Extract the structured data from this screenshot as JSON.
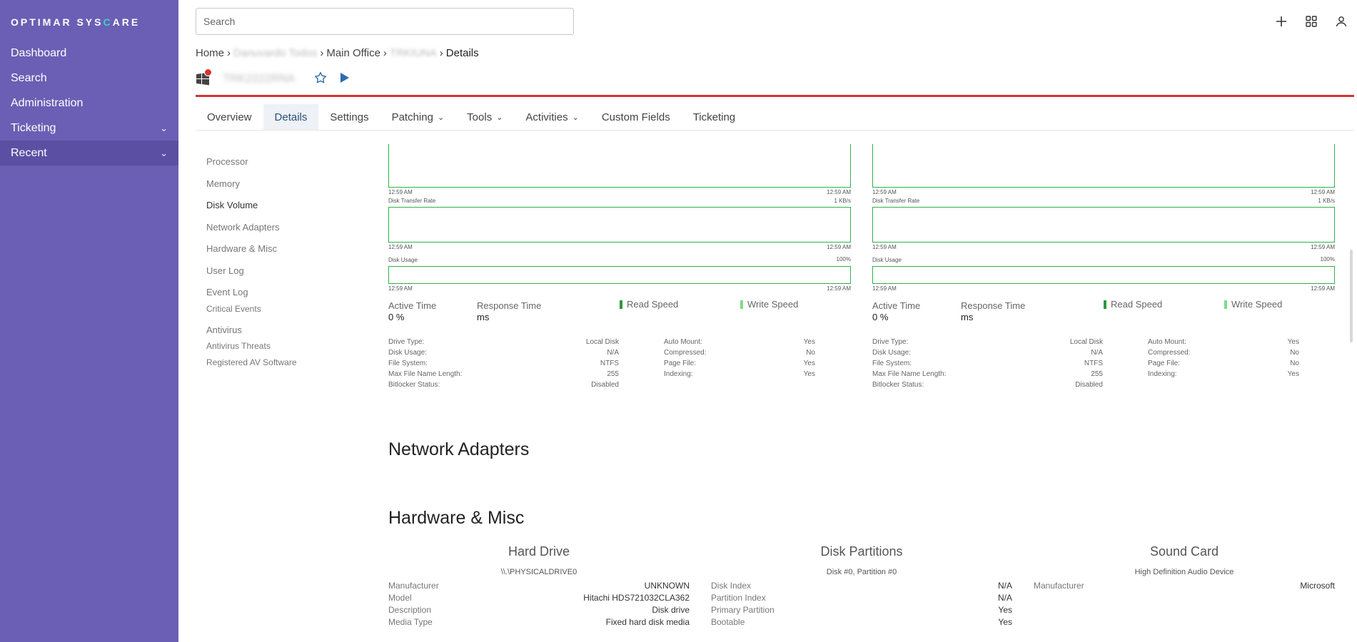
{
  "app": {
    "logo_a": "OPTIMAR SYS",
    "logo_c": "C",
    "logo_b": "ARE"
  },
  "sidebar": {
    "items": [
      {
        "label": "Dashboard",
        "chev": ""
      },
      {
        "label": "Search",
        "chev": ""
      },
      {
        "label": "Administration",
        "chev": ""
      },
      {
        "label": "Ticketing",
        "chev": "⌄"
      },
      {
        "label": "Recent",
        "chev": "⌄"
      }
    ]
  },
  "search": {
    "placeholder": "Search"
  },
  "breadcrumb": {
    "home": "Home",
    "site": "Danuvardo Todos",
    "office": "Main Office",
    "device": "TRKIUNA",
    "current": "Details",
    "sep": "›"
  },
  "device": {
    "name": "TRK2222RNA"
  },
  "tabs": [
    {
      "label": "Overview",
      "chev": ""
    },
    {
      "label": "Details",
      "chev": ""
    },
    {
      "label": "Settings",
      "chev": ""
    },
    {
      "label": "Patching",
      "chev": "⌄"
    },
    {
      "label": "Tools",
      "chev": "⌄"
    },
    {
      "label": "Activities",
      "chev": "⌄"
    },
    {
      "label": "Custom Fields",
      "chev": ""
    },
    {
      "label": "Ticketing",
      "chev": ""
    }
  ],
  "subnav": [
    "Processor",
    "Memory",
    "Disk Volume",
    "Network Adapters",
    "Hardware & Misc",
    "User Log",
    "Event Log",
    "Critical Events",
    "Antivirus",
    "Antivirus Threats",
    "Registered AV Software"
  ],
  "disk": {
    "time": "12:59 AM",
    "transfer_label": "Disk Transfer Rate",
    "transfer_max": "1 KB/s",
    "usage_label": "Disk Usage",
    "usage_max": "100%",
    "active_time_label": "Active Time",
    "active_time_val": "0 %",
    "response_time_label": "Response Time",
    "response_time_val": "ms",
    "read_speed": "Read Speed",
    "write_speed": "Write Speed",
    "read_color": "#2a9a3c",
    "write_color": "#7edb8a",
    "left_info": [
      {
        "k": "Drive Type:",
        "v": "Local Disk"
      },
      {
        "k": "Disk Usage:",
        "v": "N/A"
      },
      {
        "k": "File System:",
        "v": "NTFS"
      },
      {
        "k": "Max File Name Length:",
        "v": "255"
      },
      {
        "k": "Bitlocker Status:",
        "v": "Disabled"
      }
    ],
    "right_info": [
      {
        "k": "Auto Mount:",
        "v": "Yes"
      },
      {
        "k": "Compressed:",
        "v": "No"
      },
      {
        "k": "Page File:",
        "v": "Yes"
      },
      {
        "k": "Indexing:",
        "v": "Yes"
      }
    ],
    "right_info_2": [
      {
        "k": "Auto Mount:",
        "v": "Yes"
      },
      {
        "k": "Compressed:",
        "v": "No"
      },
      {
        "k": "Page File:",
        "v": "No"
      },
      {
        "k": "Indexing:",
        "v": "Yes"
      }
    ]
  },
  "sections": {
    "network": "Network Adapters",
    "hardware": "Hardware & Misc"
  },
  "hardware": {
    "hard_drive": {
      "title": "Hard Drive",
      "sub": "\\\\.\\PHYSICALDRIVE0",
      "rows": [
        {
          "k": "Manufacturer",
          "v": "UNKNOWN"
        },
        {
          "k": "Model",
          "v": "Hitachi HDS721032CLA362"
        },
        {
          "k": "Description",
          "v": "Disk drive"
        },
        {
          "k": "Media Type",
          "v": "Fixed hard disk media"
        }
      ]
    },
    "partitions": {
      "title": "Disk Partitions",
      "sub": "Disk #0, Partition #0",
      "rows": [
        {
          "k": "Disk Index",
          "v": "N/A"
        },
        {
          "k": "Partition Index",
          "v": "N/A"
        },
        {
          "k": "Primary Partition",
          "v": "Yes"
        },
        {
          "k": "Bootable",
          "v": "Yes"
        }
      ]
    },
    "sound": {
      "title": "Sound Card",
      "sub": "High Definition Audio Device",
      "rows": [
        {
          "k": "Manufacturer",
          "v": "Microsoft"
        }
      ]
    }
  }
}
